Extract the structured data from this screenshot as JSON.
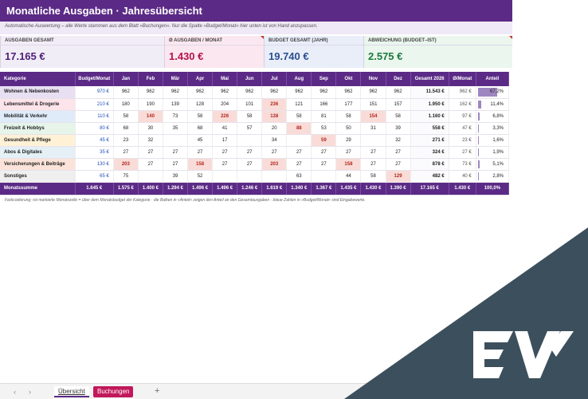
{
  "header": {
    "title": "Monatliche Ausgaben · Jahresübersicht",
    "subtitle": "Automatische Auswertung – alle Werte stammen aus dem Blatt »Buchungen«. Nur die Spalte »Budget/Monat« hier unten ist von Hand anzupassen."
  },
  "kpis": [
    {
      "label": "AUSGABEN GESAMT",
      "value": "17.165 €"
    },
    {
      "label": "Ø AUSGABEN / MONAT",
      "value": "1.430 €"
    },
    {
      "label": "BUDGET GESAMT (JAHR)",
      "value": "19.740 €"
    },
    {
      "label": "ABWEICHUNG (BUDGET–IST)",
      "value": "2.575 €"
    }
  ],
  "table": {
    "headers": [
      "Kategorie",
      "Budget/Monat",
      "Jan",
      "Feb",
      "Mär",
      "Apr",
      "Mai",
      "Jun",
      "Jul",
      "Aug",
      "Sep",
      "Okt",
      "Nov",
      "Dez",
      "Gesamt 2026",
      "Ø/Monat",
      "Anteil"
    ],
    "rows": [
      {
        "cat": "Wohnen & Nebenkosten",
        "budget": "970 €",
        "months": [
          "962",
          "962",
          "962",
          "962",
          "962",
          "962",
          "962",
          "962",
          "962",
          "962",
          "962",
          "962"
        ],
        "total": "11.543 €",
        "avg": "962 €",
        "share": "67,2%",
        "share_value": 67.2
      },
      {
        "cat": "Lebensmittel & Drogerie",
        "budget": "210 €",
        "months": [
          "180",
          "190",
          "139",
          "128",
          "204",
          "101",
          "236",
          "121",
          "166",
          "177",
          "151",
          "157"
        ],
        "total": "1.950 €",
        "avg": "162 €",
        "share": "11,4%",
        "share_value": 11.4
      },
      {
        "cat": "Mobilität & Verkehr",
        "budget": "110 €",
        "months": [
          "58",
          "140",
          "73",
          "58",
          "226",
          "58",
          "138",
          "58",
          "81",
          "58",
          "154",
          "58"
        ],
        "total": "1.160 €",
        "avg": "97 €",
        "share": "6,8%",
        "share_value": 6.8
      },
      {
        "cat": "Freizeit & Hobbys",
        "budget": "80 €",
        "months": [
          "68",
          "30",
          "35",
          "68",
          "41",
          "57",
          "20",
          "88",
          "53",
          "50",
          "31",
          "39"
        ],
        "total": "558 €",
        "avg": "47 €",
        "share": "3,3%",
        "share_value": 3.3
      },
      {
        "cat": "Gesundheit & Pflege",
        "budget": "45 €",
        "months": [
          "23",
          "32",
          "",
          "45",
          "17",
          "",
          "34",
          "",
          "59",
          "29",
          "",
          "32"
        ],
        "total": "271 €",
        "avg": "23 €",
        "share": "1,6%",
        "share_value": 1.6
      },
      {
        "cat": "Abos & Digitales",
        "budget": "35 €",
        "months": [
          "27",
          "27",
          "27",
          "27",
          "27",
          "27",
          "27",
          "27",
          "27",
          "27",
          "27",
          "27"
        ],
        "total": "324 €",
        "avg": "27 €",
        "share": "1,9%",
        "share_value": 1.9
      },
      {
        "cat": "Versicherungen & Beiträge",
        "budget": "130 €",
        "months": [
          "203",
          "27",
          "27",
          "158",
          "27",
          "27",
          "203",
          "27",
          "27",
          "158",
          "27",
          "27"
        ],
        "total": "878 €",
        "avg": "73 €",
        "share": "5,1%",
        "share_value": 5.1
      },
      {
        "cat": "Sonstiges",
        "budget": "65 €",
        "months": [
          "75",
          "",
          "39",
          "52",
          "",
          "",
          "",
          "63",
          "",
          "44",
          "58",
          "129"
        ],
        "total": "482 €",
        "avg": "40 €",
        "share": "2,8%",
        "share_value": 2.8
      }
    ],
    "sum_row": {
      "cat": "Monatssumme",
      "budget": "1.645 €",
      "months": [
        "1.575 €",
        "1.400 €",
        "1.294 €",
        "1.496 €",
        "1.496 €",
        "1.246 €",
        "1.619 €",
        "1.340 €",
        "1.367 €",
        "1.435 €",
        "1.430 €",
        "1.390 €"
      ],
      "total": "17.165 €",
      "avg": "1.430 €",
      "share": "100,0%"
    },
    "highlighted": [
      [
        1,
        6
      ],
      [
        2,
        1
      ],
      [
        2,
        4
      ],
      [
        2,
        6
      ],
      [
        2,
        10
      ],
      [
        3,
        7
      ],
      [
        4,
        8
      ],
      [
        6,
        0
      ],
      [
        6,
        3
      ],
      [
        6,
        6
      ],
      [
        6,
        9
      ],
      [
        7,
        11
      ]
    ]
  },
  "category_colors": [
    "#e8dff2",
    "#fde3ea",
    "#e0ebf9",
    "#e6f4ea",
    "#fff1d6",
    "#e4f0f5",
    "#fbe3d9",
    "#efefef"
  ],
  "footnote": "Farbcodierung: rot markierte Monatszelle = über dem Monatsbudget der Kategorie · die Balken in »Anteil« zeigen den Anteil an den Gesamtausgaben · blaue Zahlen in »Budget/Monat« sind Eingabewerte.",
  "sheet_tabs": {
    "active": "Übersicht",
    "other": "Buchungen",
    "add": "+",
    "prev": "‹",
    "next": "›"
  }
}
